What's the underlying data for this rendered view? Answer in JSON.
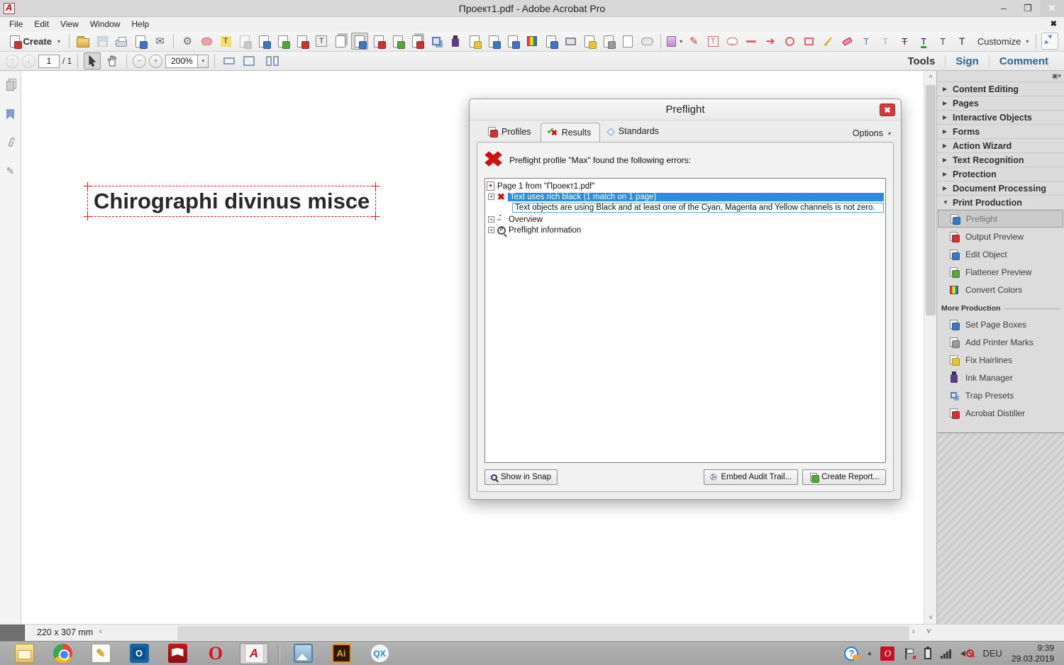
{
  "window": {
    "title": "Проект1.pdf - Adobe Acrobat Pro",
    "minimize": "–",
    "restore": "❐",
    "close": "✕",
    "doc_close": "✖"
  },
  "menu": {
    "items": [
      "File",
      "Edit",
      "View",
      "Window",
      "Help"
    ]
  },
  "toolbar1": {
    "create_label": "Create",
    "customize_label": "Customize"
  },
  "toolbar2": {
    "page_value": "1",
    "page_total": "/ 1",
    "zoom_value": "200%",
    "tabs": {
      "tools": "Tools",
      "sign": "Sign",
      "comment": "Comment"
    }
  },
  "document": {
    "text": "Chirographi divinus misce"
  },
  "dialog": {
    "title": "Preflight",
    "tabs": {
      "profiles": "Profiles",
      "results": "Results",
      "standards": "Standards"
    },
    "options_label": "Options",
    "message": "Preflight profile \"Max\" found the following errors:",
    "tree": {
      "root": "Page 1 from \"Проект1.pdf\"",
      "error_title": "Text uses rich black (1 match on 1 page)",
      "error_detail": "Text objects are using Black and at least one of the Cyan, Magenta and Yellow channels is not zero.",
      "overview": "Overview",
      "info": "Preflight information"
    },
    "buttons": {
      "show_in_snap": "Show in Snap",
      "embed_audit": "Embed Audit Trail...",
      "create_report": "Create Report..."
    }
  },
  "right_panel": {
    "sections": {
      "content_editing": "Content Editing",
      "pages": "Pages",
      "interactive_objects": "Interactive Objects",
      "forms": "Forms",
      "action_wizard": "Action Wizard",
      "text_recognition": "Text Recognition",
      "protection": "Protection",
      "document_processing": "Document Processing",
      "print_production": "Print Production"
    },
    "items": {
      "preflight": "Preflight",
      "output_preview": "Output Preview",
      "edit_object": "Edit Object",
      "flattener_preview": "Flattener Preview",
      "convert_colors": "Convert Colors"
    },
    "more_label": "More Production",
    "more_items": {
      "set_page_boxes": "Set Page Boxes",
      "add_printer_marks": "Add Printer Marks",
      "fix_hairlines": "Fix Hairlines",
      "ink_manager": "Ink Manager",
      "trap_presets": "Trap Presets",
      "acrobat_distiller": "Acrobat Distiller"
    }
  },
  "status_bar": {
    "size_label": "220 x 307 mm",
    "scroll_left": "‹",
    "scroll_right": "›",
    "scroll_up": "˄",
    "scroll_down": "˅"
  },
  "taskbar": {
    "tray": {
      "lang": "DEU",
      "time": "9:39",
      "date": "29.03.2019"
    }
  },
  "icons": {
    "envelope": "✉",
    "gear": "⚙",
    "caret-down": "▾",
    "tri-right": "▶",
    "tri-down": "▼",
    "plus": "+",
    "minus": "−",
    "up-arrow": "↑",
    "down-arrow": "↓",
    "cursor": "➤",
    "hand": "✋",
    "t-letter": "T",
    "t-boxed": "T",
    "red-arrow": "➔",
    "pencil": "✎",
    "paperclip": "✇",
    "x-mark": "✖",
    "check": "✔",
    "diamond": "◇",
    "expand-plus": "+",
    "question": "?",
    "opera-o": "O",
    "ai-label": "Ai",
    "qx-label": "QX",
    "outlook-o": "O",
    "acrobat-a": "A",
    "red-swirl": "O"
  }
}
